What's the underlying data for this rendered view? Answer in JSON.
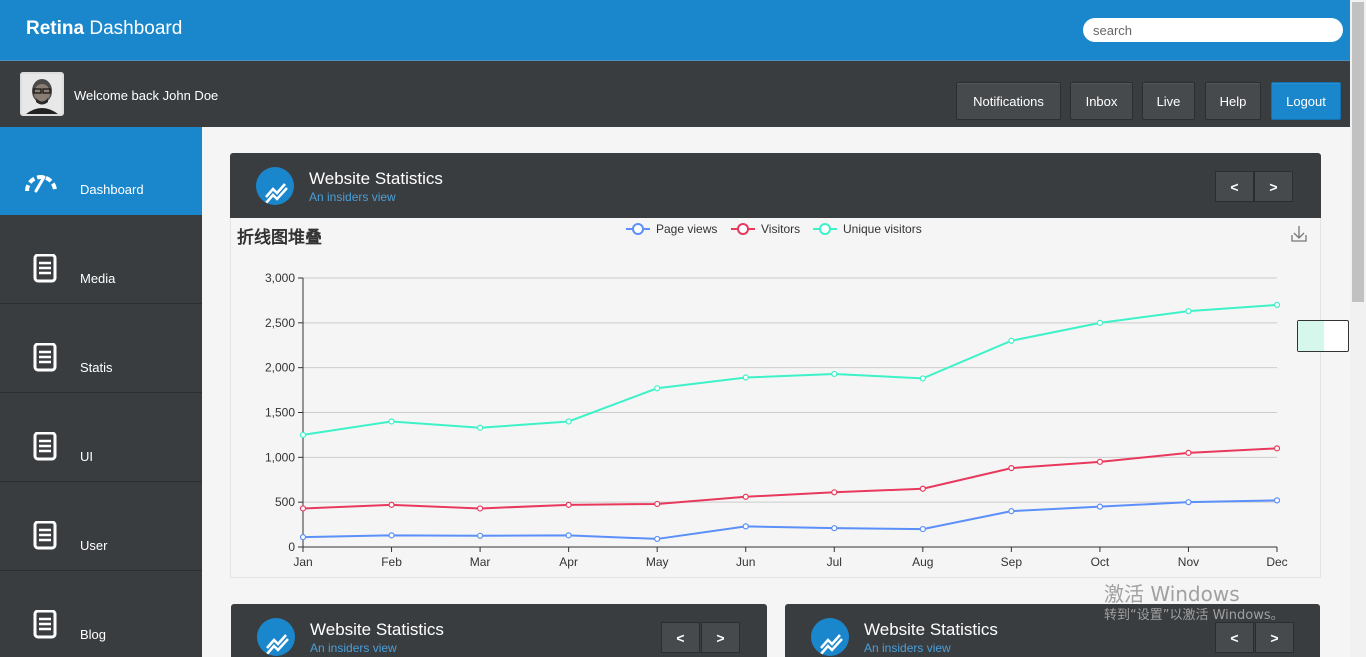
{
  "header": {
    "brand_bold": "Retina",
    "brand_light": "Dashboard",
    "search_placeholder": "search"
  },
  "userbar": {
    "welcome": "Welcome back John Doe",
    "buttons": [
      "Notifications",
      "Inbox",
      "Live",
      "Help",
      "Logout"
    ]
  },
  "sidebar": {
    "items": [
      {
        "label": "Dashboard",
        "icon": "speedometer-icon",
        "active": true
      },
      {
        "label": "Media",
        "icon": "document-icon"
      },
      {
        "label": "Statis",
        "icon": "document-icon"
      },
      {
        "label": "UI",
        "icon": "document-icon"
      },
      {
        "label": "User",
        "icon": "document-icon"
      },
      {
        "label": "Blog",
        "icon": "document-icon"
      }
    ]
  },
  "panels": [
    {
      "title": "Website Statistics",
      "subtitle": "An insiders view",
      "prev": "<",
      "next": ">"
    },
    {
      "title": "Website Statistics",
      "subtitle": "An insiders view",
      "prev": "<",
      "next": ">"
    },
    {
      "title": "Website Statistics",
      "subtitle": "An insiders view",
      "prev": "<",
      "next": ">"
    }
  ],
  "colors": {
    "accent": "#1a87cd",
    "dark": "#3a3d40",
    "page_views": "#5b8ff9",
    "visitors": "#e8395d",
    "unique_visitors": "#3df2c8"
  },
  "chart_data": {
    "type": "line",
    "title": "折线图堆叠",
    "categories": [
      "Jan",
      "Feb",
      "Mar",
      "Apr",
      "May",
      "Jun",
      "Jul",
      "Aug",
      "Sep",
      "Oct",
      "Nov",
      "Dec"
    ],
    "series": [
      {
        "name": "Page views",
        "values": [
          110,
          130,
          125,
          130,
          90,
          230,
          210,
          200,
          400,
          450,
          500,
          520
        ]
      },
      {
        "name": "Visitors",
        "values": [
          430,
          470,
          430,
          470,
          480,
          560,
          610,
          650,
          880,
          950,
          1050,
          1100
        ]
      },
      {
        "name": "Unique visitors",
        "values": [
          1250,
          1400,
          1330,
          1400,
          1770,
          1890,
          1930,
          1880,
          2300,
          2500,
          2630,
          2700
        ]
      }
    ],
    "yticks": [
      "0",
      "500",
      "1,000",
      "1,500",
      "2,000",
      "2,500",
      "3,000"
    ],
    "ylim": [
      0,
      3000
    ],
    "grid": true,
    "legend": "top-center"
  },
  "watermark": {
    "line1": "激活 Windows",
    "line2": "转到“设置”以激活 Windows。"
  }
}
